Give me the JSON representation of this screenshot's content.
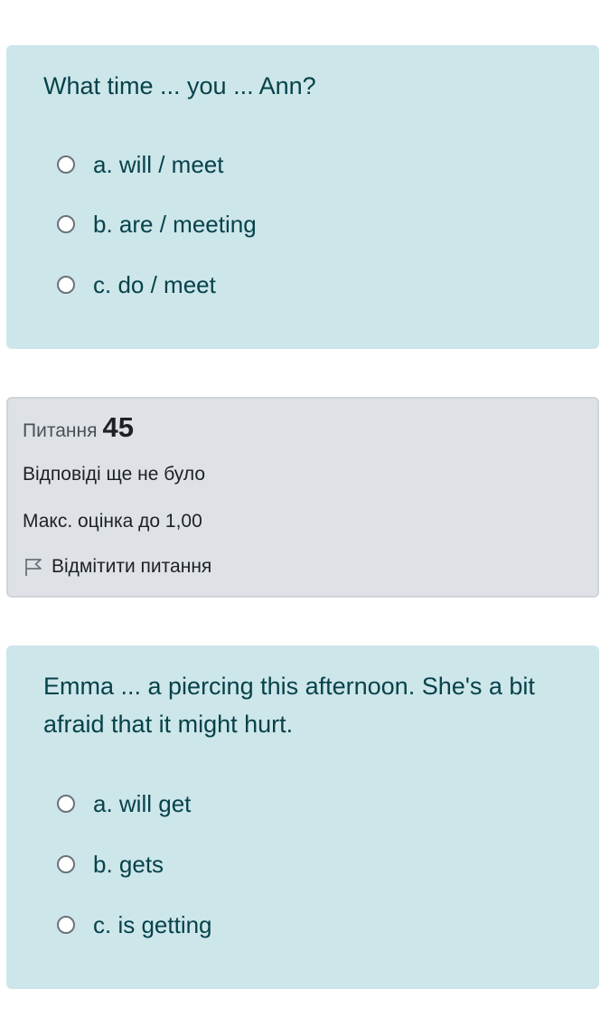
{
  "question_1": {
    "text": "What time ... you ... Ann?",
    "options": [
      {
        "label": "a. will / meet"
      },
      {
        "label": "b. are / meeting"
      },
      {
        "label": "c. do / meet"
      }
    ]
  },
  "question_info": {
    "prefix": "Питання",
    "number": "45",
    "status": "Відповіді ще не було",
    "max_grade": "Макс. оцінка до 1,00",
    "flag_label": "Відмітити питання",
    "flag_icon": "flag-outline-icon"
  },
  "question_2": {
    "text": "Emma ... a piercing this afternoon. She's a bit afraid that it might hurt.",
    "options": [
      {
        "label": "a. will get"
      },
      {
        "label": "b. gets"
      },
      {
        "label": "c. is getting"
      }
    ]
  },
  "colors": {
    "formulation_bg": "#cde6ea",
    "formulation_text": "#06424a",
    "info_bg": "#dee2e6",
    "info_border": "#cfd4da"
  }
}
